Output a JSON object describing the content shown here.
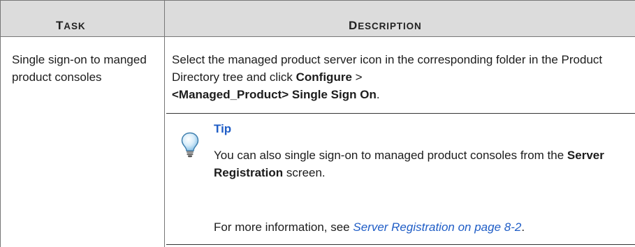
{
  "table": {
    "headers": {
      "task": {
        "first": "T",
        "rest": "ASK"
      },
      "description": {
        "first": "D",
        "rest": "ESCRIPTION"
      }
    },
    "row": {
      "task": "Single sign-on to manged product consoles",
      "description": {
        "text_before": "Select the managed product server icon in the corresponding folder in the Product Directory tree and click ",
        "bold_configure": "Configure",
        "separator": " > ",
        "bold_sso": "<Managed_Product> Single Sign On",
        "end": "."
      }
    }
  },
  "tip": {
    "icon": "lightbulb-icon",
    "title": "Tip",
    "body_before": "You can also single sign-on to managed product consoles from the ",
    "bold_screen": "Server Registration",
    "body_after": " screen.",
    "more_before": "For more information, see ",
    "link_text": "Server Registration on page 8-2",
    "more_after": "."
  },
  "colors": {
    "header_bg": "#dcdcdc",
    "link": "#1f5dc6",
    "rule": "#777777"
  }
}
